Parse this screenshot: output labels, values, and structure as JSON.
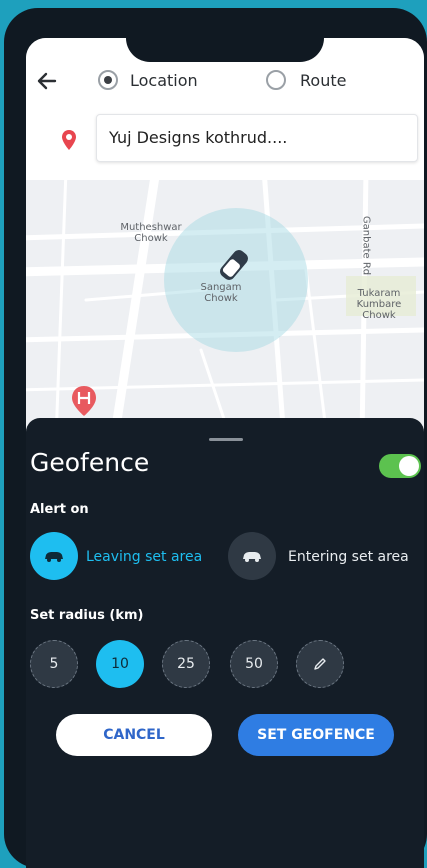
{
  "mode_selector": {
    "options": [
      {
        "label": "Location",
        "selected": true
      },
      {
        "label": "Route",
        "selected": false
      }
    ]
  },
  "search": {
    "value": "Yuj Designs kothrud...."
  },
  "map": {
    "labels": [
      "Mutheshwar Chowk",
      "Sangam Chowk",
      "Tukaram Kumbare Chowk",
      "Ganbate Rd"
    ],
    "marker_icon": "car-icon",
    "poi_icon": "hospital-icon",
    "pin_icon": "location-pin-icon",
    "accent_color": "#1ebef0"
  },
  "geofence": {
    "title": "Geofence",
    "enabled": true,
    "toggle_color": "#5cc24f",
    "alert_on_label": "Alert on",
    "alert_options": [
      {
        "label": "Leaving set area",
        "selected": true
      },
      {
        "label": "Entering set area",
        "selected": false
      }
    ],
    "radius_label": "Set radius (km)",
    "radius_options": [
      "5",
      "10",
      "25",
      "50"
    ],
    "selected_radius": "10",
    "edit_icon": "pencil-icon",
    "buttons": {
      "cancel": "CANCEL",
      "set": "SET GEOFENCE"
    }
  }
}
